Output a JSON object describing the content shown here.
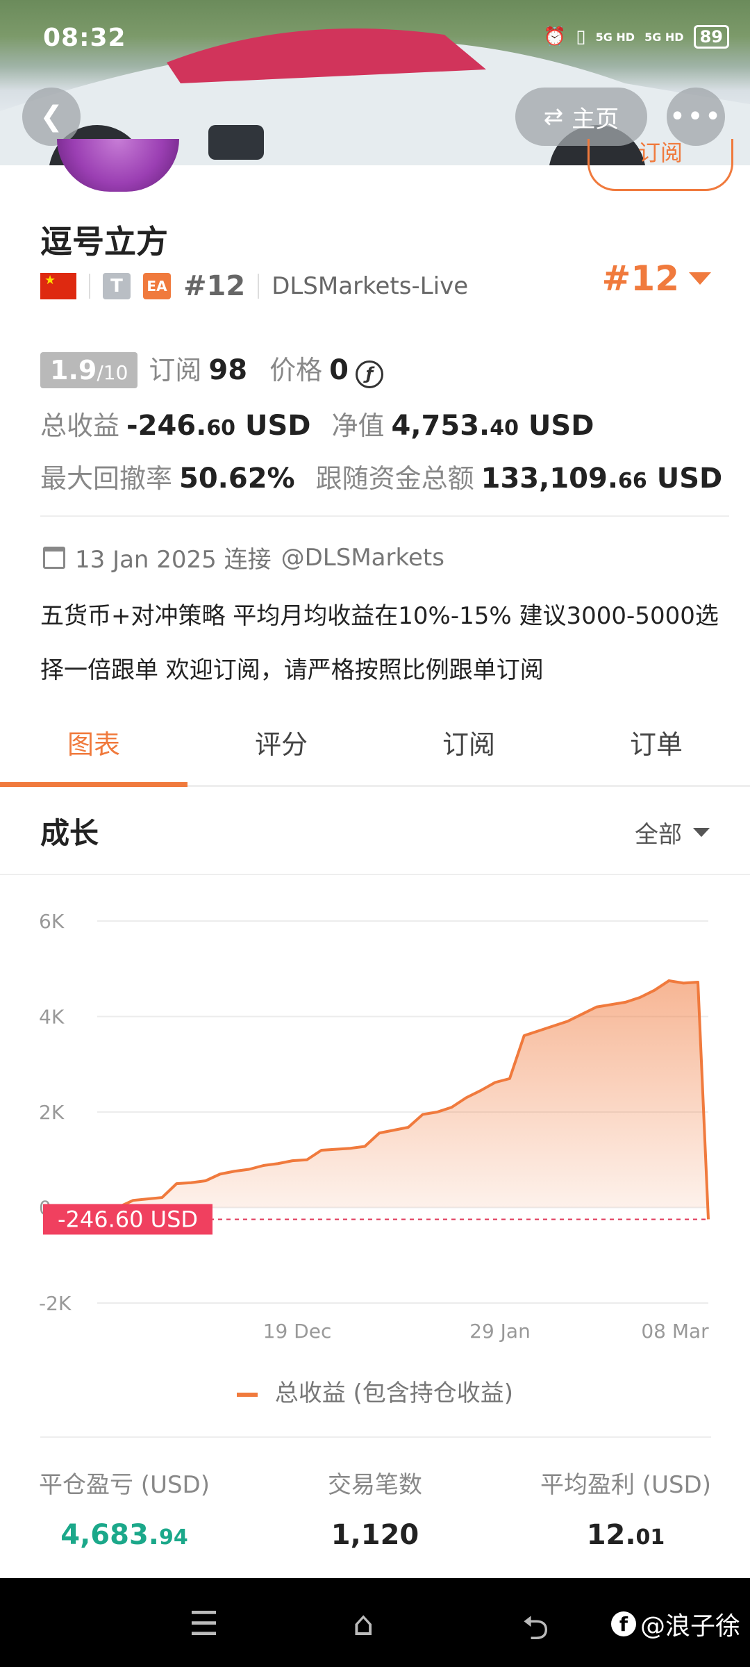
{
  "status_bar": {
    "time": "08:32",
    "signal1": "5G HD",
    "signal2": "5G HD",
    "battery": "89"
  },
  "header": {
    "home_label": "主页",
    "subscribe_label": "订阅"
  },
  "profile": {
    "name": "逗号立方",
    "badge_t": "T",
    "badge_ea": "EA",
    "rank_small": "#12",
    "broker": "DLSMarkets-Live",
    "rank_big": "#12"
  },
  "stats": {
    "score_main": "1.9",
    "score_den": "/10",
    "subscribe_label": "订阅",
    "subscribe_count": "98",
    "price_label": "价格",
    "price_value": "0",
    "price_coin": "ƒ",
    "total_profit_label": "总收益",
    "total_profit_int": "-246.",
    "total_profit_dec": "60",
    "total_profit_unit": "USD",
    "equity_label": "净值",
    "equity_int": "4,753.",
    "equity_dec": "40",
    "equity_unit": "USD",
    "drawdown_label": "最大回撤率",
    "drawdown_value": "50.62%",
    "follow_label": "跟随资金总额",
    "follow_int": "133,109.",
    "follow_dec": "66",
    "follow_unit": "USD"
  },
  "connection": {
    "date": "13 Jan 2025 连接",
    "account": "@DLSMarkets"
  },
  "description": "五货币+对冲策略 平均月均收益在10%-15% 建议3000-5000选择一倍跟单 欢迎订阅，请严格按照比例跟单订阅",
  "tabs": [
    {
      "label": "图表",
      "active": true
    },
    {
      "label": "评分",
      "active": false
    },
    {
      "label": "订阅",
      "active": false
    },
    {
      "label": "订单",
      "active": false
    }
  ],
  "section": {
    "title": "成长",
    "range": "全部"
  },
  "chart_data": {
    "type": "area",
    "ylim": [
      -2000,
      6000
    ],
    "yticks": [
      "6K",
      "4K",
      "2K",
      "0",
      "-2K"
    ],
    "ytick_values": [
      6000,
      4000,
      2000,
      0,
      -2000
    ],
    "xticks": [
      "19 Dec",
      "29 Jan",
      "08 Mar"
    ],
    "current_label": "-246.60 USD",
    "current_value": -246.6,
    "color": "#f07a3d",
    "series": [
      {
        "name": "总收益 (包含持仓收益)",
        "values": [
          0,
          10,
          150,
          180,
          210,
          500,
          520,
          560,
          700,
          760,
          800,
          880,
          920,
          980,
          1000,
          1200,
          1220,
          1240,
          1280,
          1560,
          1620,
          1680,
          1950,
          2000,
          2100,
          2300,
          2450,
          2620,
          2700,
          3600,
          3700,
          3800,
          3900,
          4050,
          4200,
          4250,
          4300,
          4400,
          4550,
          4750,
          4700,
          4720,
          -246.6
        ]
      }
    ]
  },
  "legend_label": "总收益 (包含持仓收益)",
  "summary": [
    {
      "label": "平仓盈亏 (USD)",
      "int": "4,683.",
      "dec": "94"
    },
    {
      "label": "交易笔数",
      "int": "1,120",
      "dec": ""
    },
    {
      "label": "平均盈利 (USD)",
      "int": "12.",
      "dec": "01"
    }
  ],
  "watermark": "@浪子徐"
}
